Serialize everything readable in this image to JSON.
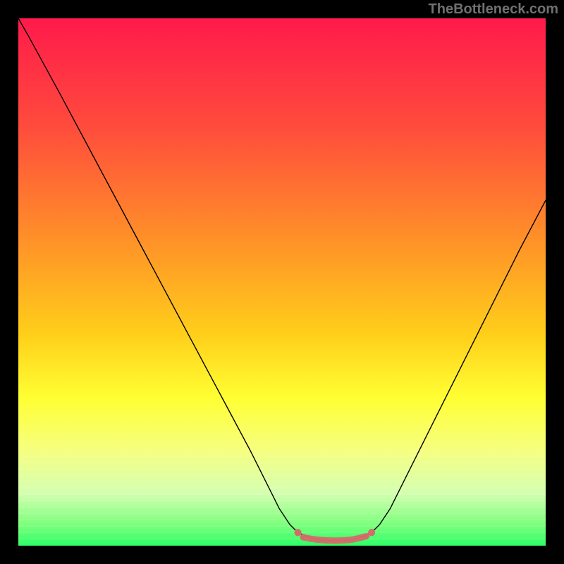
{
  "watermark": "TheBottleneck.com",
  "chart_data": {
    "type": "line",
    "title": "",
    "xlabel": "",
    "ylabel": "",
    "xlim": [
      0,
      100
    ],
    "ylim": [
      0,
      100
    ],
    "gradient_stops": [
      {
        "offset": 0.0,
        "color": "#ff1a4b"
      },
      {
        "offset": 0.2,
        "color": "#ff4a3d"
      },
      {
        "offset": 0.4,
        "color": "#ff8a2a"
      },
      {
        "offset": 0.6,
        "color": "#ffcf1a"
      },
      {
        "offset": 0.72,
        "color": "#ffff33"
      },
      {
        "offset": 0.82,
        "color": "#f6ff80"
      },
      {
        "offset": 0.9,
        "color": "#d4ffb0"
      },
      {
        "offset": 0.96,
        "color": "#7cff7c"
      },
      {
        "offset": 1.0,
        "color": "#2cff68"
      }
    ],
    "series": [
      {
        "name": "bottleneck-curve",
        "color": "#000000",
        "width": 1.4,
        "points": [
          [
            0.0,
            100.0
          ],
          [
            2.0,
            96.5
          ],
          [
            5.0,
            91.0
          ],
          [
            8.0,
            85.5
          ],
          [
            12.0,
            78.0
          ],
          [
            16.0,
            70.5
          ],
          [
            20.0,
            63.0
          ],
          [
            24.0,
            55.5
          ],
          [
            28.0,
            48.0
          ],
          [
            32.0,
            40.5
          ],
          [
            36.0,
            33.0
          ],
          [
            40.0,
            25.5
          ],
          [
            44.0,
            18.0
          ],
          [
            47.0,
            12.0
          ],
          [
            49.5,
            7.0
          ],
          [
            51.5,
            4.0
          ],
          [
            53.0,
            2.5
          ],
          [
            54.5,
            1.8
          ],
          [
            56.0,
            1.3
          ],
          [
            58.0,
            1.0
          ],
          [
            60.0,
            0.9
          ],
          [
            62.0,
            1.0
          ],
          [
            64.0,
            1.3
          ],
          [
            65.5,
            1.8
          ],
          [
            67.0,
            2.5
          ],
          [
            68.5,
            4.0
          ],
          [
            70.5,
            7.0
          ],
          [
            73.0,
            12.0
          ],
          [
            76.0,
            18.0
          ],
          [
            79.0,
            24.0
          ],
          [
            83.0,
            32.0
          ],
          [
            87.0,
            40.0
          ],
          [
            91.0,
            48.0
          ],
          [
            95.0,
            56.0
          ],
          [
            100.0,
            65.5
          ]
        ]
      }
    ],
    "markers": {
      "color": "#d66a6a",
      "radius": 5,
      "caps": [
        [
          53.0,
          2.5
        ],
        [
          67.0,
          2.5
        ]
      ],
      "band": [
        [
          54.0,
          1.6
        ],
        [
          55.5,
          1.3
        ],
        [
          57.0,
          1.1
        ],
        [
          58.5,
          1.0
        ],
        [
          60.0,
          0.95
        ],
        [
          61.5,
          1.0
        ],
        [
          63.0,
          1.1
        ],
        [
          64.5,
          1.4
        ],
        [
          66.0,
          1.8
        ]
      ]
    }
  }
}
